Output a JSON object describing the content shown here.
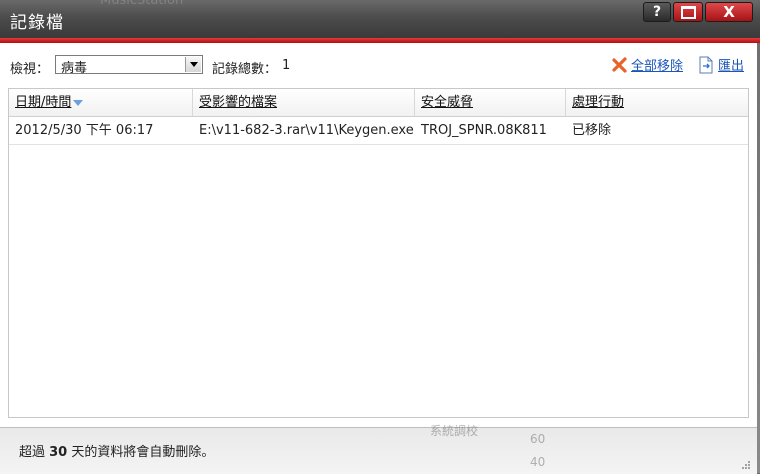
{
  "window": {
    "title": "記錄檔",
    "ghost_title": "MusicStation",
    "help_label": "?",
    "close_label": "X"
  },
  "toolbar": {
    "view_label": "檢視：",
    "view_selected": "病毒",
    "count_label": "記錄總數：",
    "count_value": "1",
    "remove_all_label": "全部移除",
    "export_label": "匯出"
  },
  "table": {
    "columns": [
      "日期/時間",
      "受影響的檔案",
      "安全威脅",
      "處理行動"
    ],
    "rows": [
      [
        "2012/5/30 下午 06:17",
        "E:\\v11-682-3.rar\\v11\\Keygen.exe",
        "TROJ_SPNR.08K811",
        "已移除"
      ]
    ]
  },
  "footer": {
    "note_prefix": "超過 ",
    "note_days": "30",
    "note_suffix": " 天的資料將會自動刪除。"
  },
  "background_ghost": {
    "tuning": "系統調校",
    "num1": "60",
    "num2": "40"
  },
  "colors": {
    "accent_red": "#c8161c",
    "link_blue": "#1a55b8"
  }
}
